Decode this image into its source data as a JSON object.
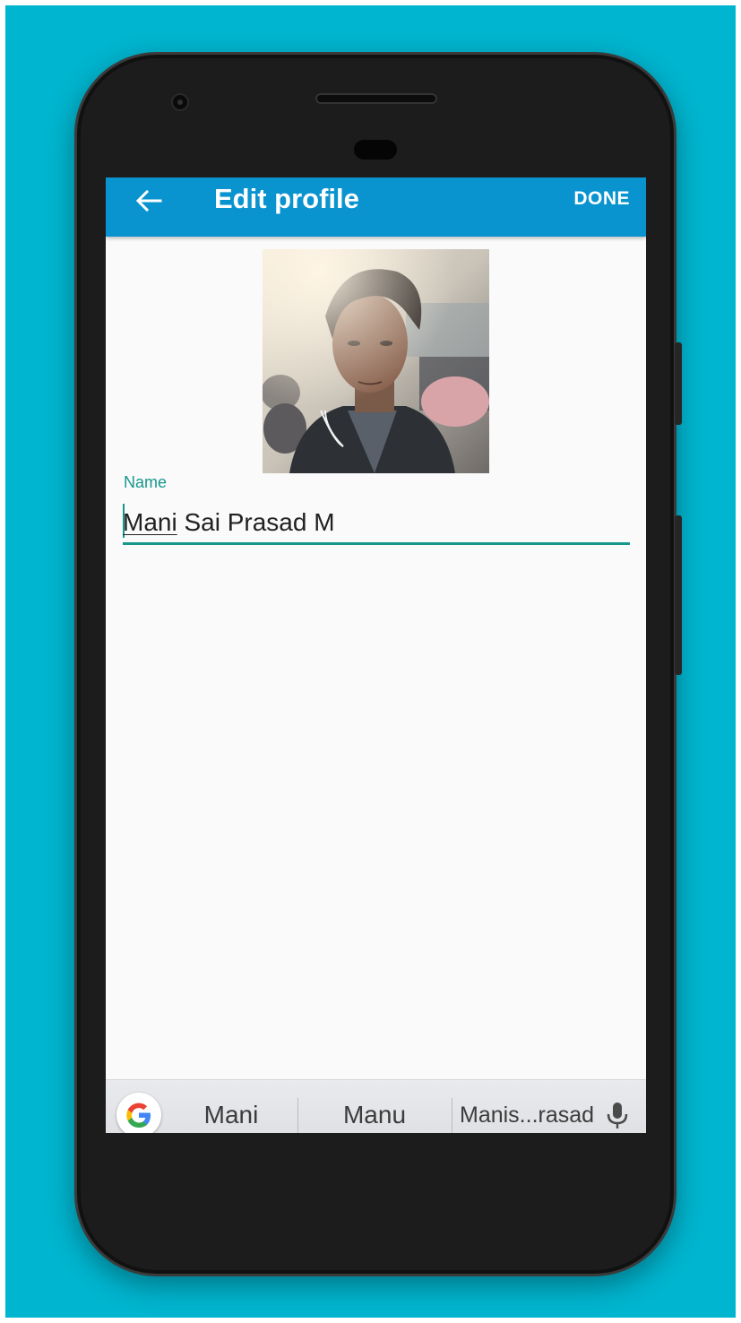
{
  "appbar": {
    "title": "Edit profile",
    "done_label": "DONE"
  },
  "profile": {
    "name_label": "Name",
    "name_first_word": "Mani",
    "name_rest": " Sai Prasad M"
  },
  "keyboard_suggestions": {
    "items": [
      "Mani",
      "Manu",
      "Manis...rasad"
    ]
  },
  "icons": {
    "back": "arrow-back-icon",
    "google": "google-g-icon",
    "mic": "microphone-icon"
  },
  "colors": {
    "appbar": "#0993cf",
    "accent": "#17978c",
    "background": "#00b5cf"
  }
}
